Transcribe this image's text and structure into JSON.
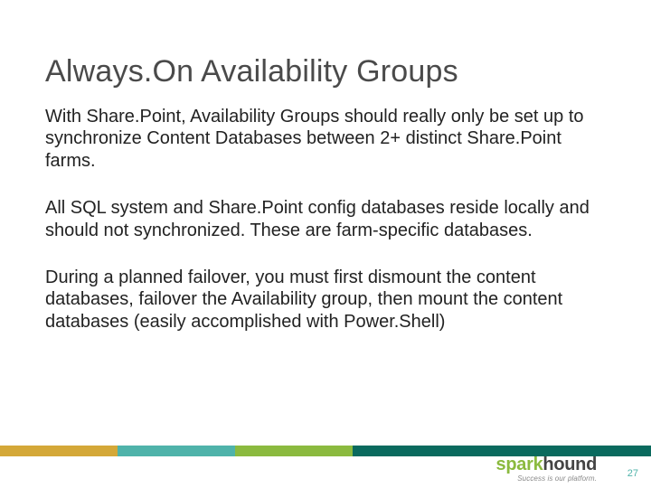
{
  "title": "Always.On Availability Groups",
  "paragraphs": [
    "With Share.Point, Availability Groups should really only be set up to synchronize Content Databases between 2+ distinct Share.Point farms.",
    "All SQL system and Share.Point config databases reside locally and should not synchronized. These are farm-specific databases.",
    "During a planned failover, you must first dismount the content databases, failover the Availability group, then mount the content databases (easily accomplished with Power.Shell)"
  ],
  "logo": {
    "word1": "spark",
    "word2": "hound",
    "tagline": "Success is our platform."
  },
  "page_number": "27",
  "colors": {
    "gold": "#d4a838",
    "teal": "#4fb3aa",
    "green": "#8bba3f",
    "dark_green": "#0a6a5e"
  }
}
